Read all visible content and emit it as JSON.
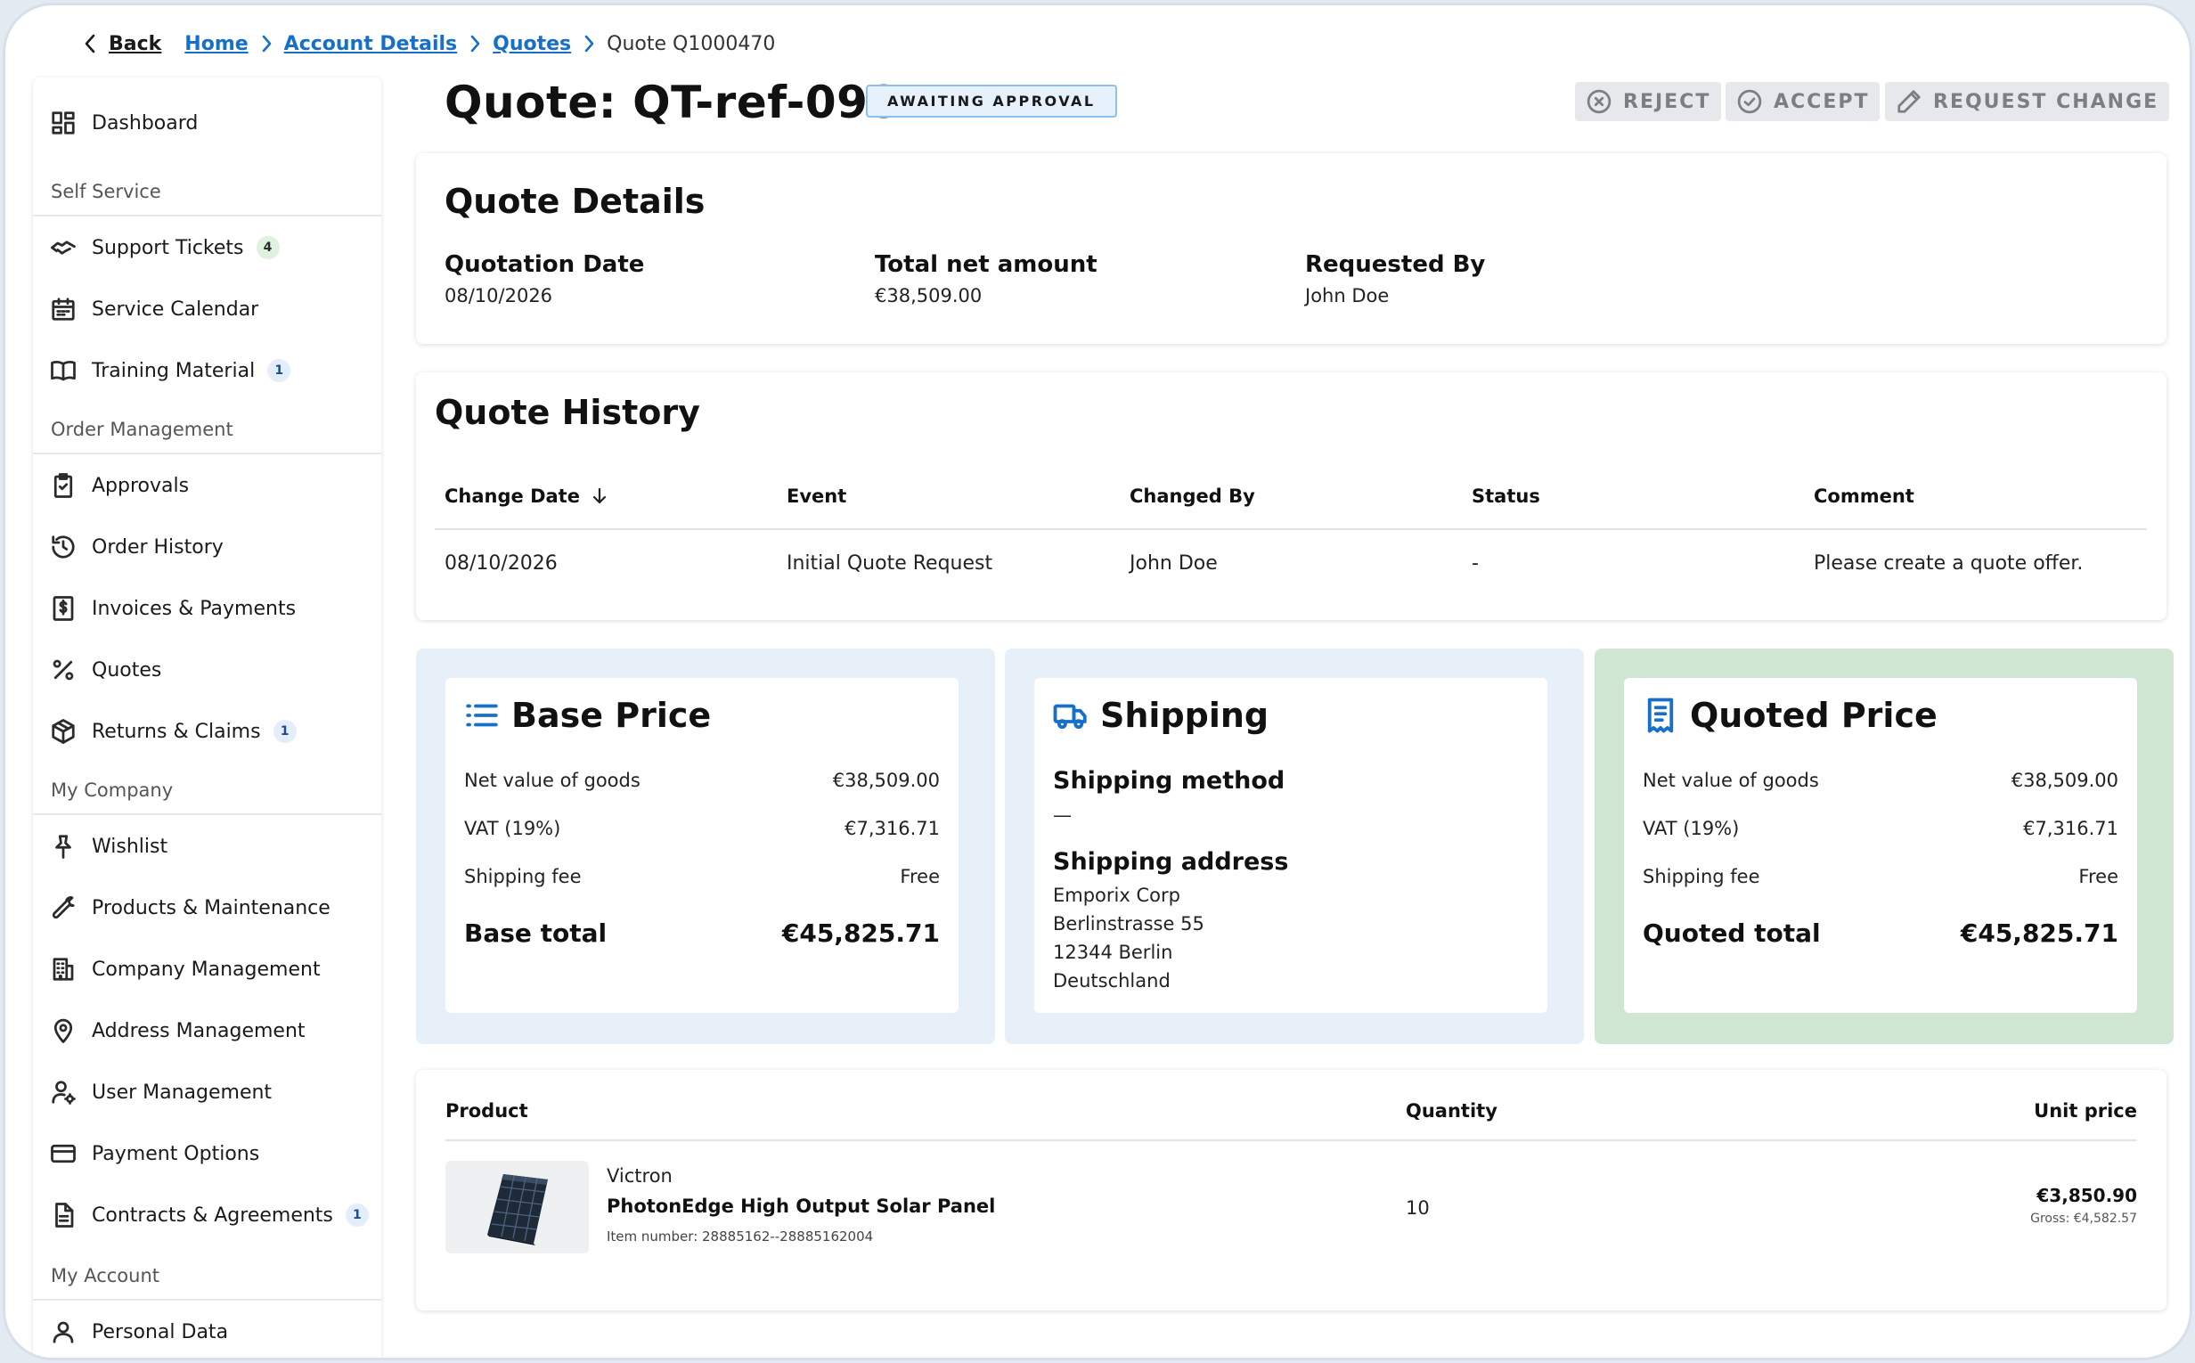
{
  "breadcrumb": {
    "back_label": "Back",
    "items": [
      "Home",
      "Account Details",
      "Quotes"
    ],
    "current": "Quote Q1000470"
  },
  "sidebar": {
    "dashboard": "Dashboard",
    "sections": {
      "self_service": "Self Service",
      "order_management": "Order Management",
      "my_company": "My Company",
      "my_account": "My Account"
    },
    "items": {
      "support_tickets": {
        "label": "Support Tickets",
        "badge": "4"
      },
      "service_calendar": {
        "label": "Service Calendar"
      },
      "training_material": {
        "label": "Training Material",
        "badge": "1"
      },
      "approvals": {
        "label": "Approvals"
      },
      "order_history": {
        "label": "Order History"
      },
      "invoices_payments": {
        "label": "Invoices & Payments"
      },
      "quotes": {
        "label": "Quotes"
      },
      "returns_claims": {
        "label": "Returns & Claims",
        "badge": "1"
      },
      "wishlist": {
        "label": "Wishlist"
      },
      "products_maintenance": {
        "label": "Products & Maintenance"
      },
      "company_management": {
        "label": "Company Management"
      },
      "address_management": {
        "label": "Address Management"
      },
      "user_management": {
        "label": "User Management"
      },
      "payment_options": {
        "label": "Payment Options"
      },
      "contracts_agreements": {
        "label": "Contracts & Agreements",
        "badge": "1"
      },
      "personal_data": {
        "label": "Personal Data"
      }
    }
  },
  "header": {
    "title": "Quote: QT-ref-0987",
    "status": "AWAITING APPROVAL",
    "actions": {
      "reject": "REJECT",
      "accept": "ACCEPT",
      "request_change": "REQUEST CHANGE"
    }
  },
  "quote_details": {
    "heading": "Quote Details",
    "quotation_date_label": "Quotation Date",
    "quotation_date": "08/10/2026",
    "total_net_label": "Total net amount",
    "total_net": "€38,509.00",
    "requested_by_label": "Requested By",
    "requested_by": "John Doe"
  },
  "quote_history": {
    "heading": "Quote History",
    "columns": [
      "Change Date",
      "Event",
      "Changed By",
      "Status",
      "Comment"
    ],
    "rows": [
      [
        "08/10/2026",
        "Initial Quote Request",
        "John Doe",
        "-",
        "Please create a quote offer."
      ]
    ]
  },
  "base_price": {
    "heading": "Base Price",
    "net_label": "Net value of goods",
    "net": "€38,509.00",
    "vat_label": "VAT (19%)",
    "vat": "€7,316.71",
    "fee_label": "Shipping fee",
    "fee": "Free",
    "total_label": "Base total",
    "total": "€45,825.71"
  },
  "shipping": {
    "heading": "Shipping",
    "method_label": "Shipping method",
    "method": "—",
    "address_label": "Shipping address",
    "address": [
      "Emporix Corp",
      "Berlinstrasse 55",
      "12344 Berlin",
      "Deutschland"
    ]
  },
  "quoted_price": {
    "heading": "Quoted Price",
    "net_label": "Net value of goods",
    "net": "€38,509.00",
    "vat_label": "VAT (19%)",
    "vat": "€7,316.71",
    "fee_label": "Shipping fee",
    "fee": "Free",
    "total_label": "Quoted total",
    "total": "€45,825.71"
  },
  "products": {
    "columns": {
      "product": "Product",
      "quantity": "Quantity",
      "unit_price": "Unit price"
    },
    "items": [
      {
        "brand": "Victron",
        "name": "PhotonEdge High Output Solar Panel",
        "item_number": "Item number: 28885162--28885162004",
        "quantity": "10",
        "unit_price": "€3,850.90",
        "gross": "Gross: €4,582.57"
      }
    ]
  },
  "colors": {
    "accent": "#1670c9",
    "panel_blue": "#e7f0f9",
    "panel_green": "#cfe7d2"
  }
}
